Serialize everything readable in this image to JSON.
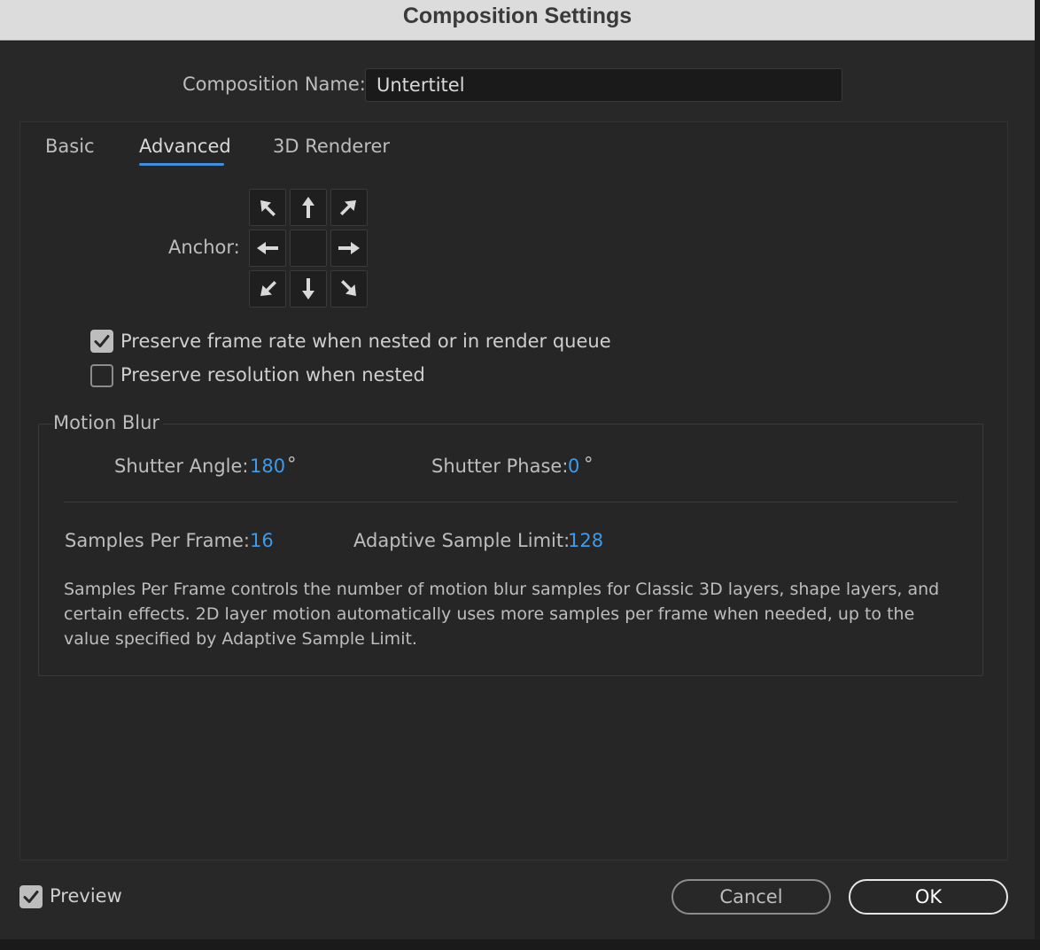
{
  "window": {
    "title": "Composition Settings"
  },
  "composition_name": {
    "label": "Composition Name:",
    "value": "Untertitel"
  },
  "tabs": [
    {
      "label": "Basic",
      "active": false
    },
    {
      "label": "Advanced",
      "active": true
    },
    {
      "label": "3D Renderer",
      "active": false
    }
  ],
  "anchor": {
    "label": "Anchor:",
    "cells": [
      "arrow-up-left-icon",
      "arrow-up-icon",
      "arrow-up-right-icon",
      "arrow-left-icon",
      "center",
      "arrow-right-icon",
      "arrow-down-left-icon",
      "arrow-down-icon",
      "arrow-down-right-icon"
    ],
    "selected": "center"
  },
  "options": {
    "preserve_frame_rate": {
      "label": "Preserve frame rate when nested or in render queue",
      "checked": true
    },
    "preserve_resolution": {
      "label": "Preserve resolution when nested",
      "checked": false
    }
  },
  "motion_blur": {
    "title": "Motion Blur",
    "shutter_angle": {
      "label": "Shutter Angle:",
      "value": "180",
      "unit": "°"
    },
    "shutter_phase": {
      "label": "Shutter Phase:",
      "value": "0",
      "unit": "°"
    },
    "samples_per_frame": {
      "label": "Samples Per Frame:",
      "value": "16"
    },
    "adaptive_sample_limit": {
      "label": "Adaptive Sample Limit:",
      "value": "128"
    },
    "description": "Samples Per Frame controls the number of motion blur samples for Classic 3D layers, shape layers, and certain effects. 2D layer motion automatically uses more samples per frame when needed, up to the value specified by Adaptive Sample Limit."
  },
  "footer": {
    "preview": {
      "label": "Preview",
      "checked": true
    },
    "cancel_label": "Cancel",
    "ok_label": "OK"
  },
  "colors": {
    "accent": "#3d8fe0",
    "value_blue": "#3d9be9",
    "background": "#282828",
    "titlebar": "#dcdcdc"
  }
}
